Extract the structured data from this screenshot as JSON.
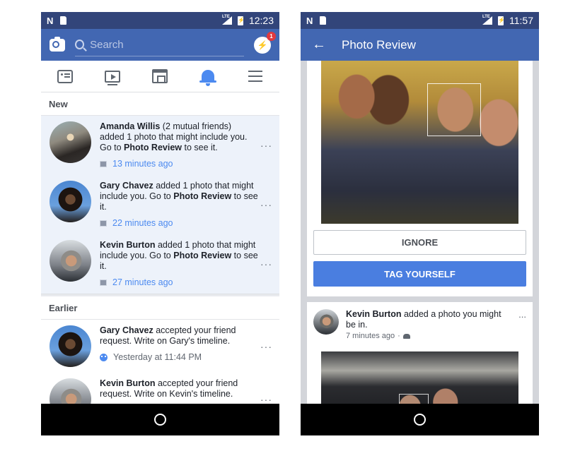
{
  "left_phone": {
    "status_bar": {
      "time": "12:23",
      "network": "LTE"
    },
    "app_bar": {
      "search_placeholder": "Search",
      "messenger_badge": "1"
    },
    "tabs": [
      {
        "name": "news-feed",
        "icon": "news-feed-icon",
        "active": false
      },
      {
        "name": "watch",
        "icon": "video-icon",
        "active": false
      },
      {
        "name": "marketplace",
        "icon": "marketplace-icon",
        "active": false
      },
      {
        "name": "notifications",
        "icon": "bell-icon",
        "active": true
      },
      {
        "name": "menu",
        "icon": "menu-icon",
        "active": false
      }
    ],
    "sections": {
      "new_label": "New",
      "earlier_label": "Earlier"
    },
    "notifications_new": [
      {
        "name": "Amanda Willis",
        "text_before": " (2 mutual friends) added 1 photo that might include you. Go to ",
        "bold2": "Photo Review",
        "text_after": " to see it.",
        "time": "13 minutes ago",
        "icon": "photo-icon"
      },
      {
        "name": "Gary Chavez",
        "text_before": " added 1 photo that might include you. Go to ",
        "bold2": "Photo Review",
        "text_after": " to see it.",
        "time": "22 minutes ago",
        "icon": "photo-icon"
      },
      {
        "name": "Kevin Burton",
        "text_before": " added 1 photo that might include you. Go to ",
        "bold2": "Photo Review",
        "text_after": " to see it.",
        "time": "27 minutes ago",
        "icon": "photo-icon"
      }
    ],
    "notifications_earlier": [
      {
        "name": "Gary Chavez",
        "text": " accepted your friend request. Write on Gary's timeline.",
        "time": "Yesterday at 11:44 PM",
        "icon": "friends-icon"
      },
      {
        "name": "Kevin Burton",
        "text": " accepted your friend request. Write on Kevin's timeline.",
        "time": "",
        "icon": "friends-icon"
      }
    ],
    "more_label": "···"
  },
  "right_phone": {
    "status_bar": {
      "time": "11:57",
      "network": "LTE"
    },
    "app_bar": {
      "back_icon": "←",
      "title": "Photo Review"
    },
    "buttons": {
      "ignore": "IGNORE",
      "tag_yourself": "TAG YOURSELF"
    },
    "post": {
      "author": "Kevin Burton",
      "text": " added a photo you might be in.",
      "time": "7 minutes ago",
      "separator": "·",
      "privacy": "friends",
      "more_label": "..."
    }
  },
  "colors": {
    "status_bar": "#32457a",
    "app_bar": "#4267b2",
    "accent_blue": "#4c8af0",
    "tag_button": "#4a7ee0",
    "new_bg": "#edf2fa",
    "badge": "#e0393e"
  }
}
